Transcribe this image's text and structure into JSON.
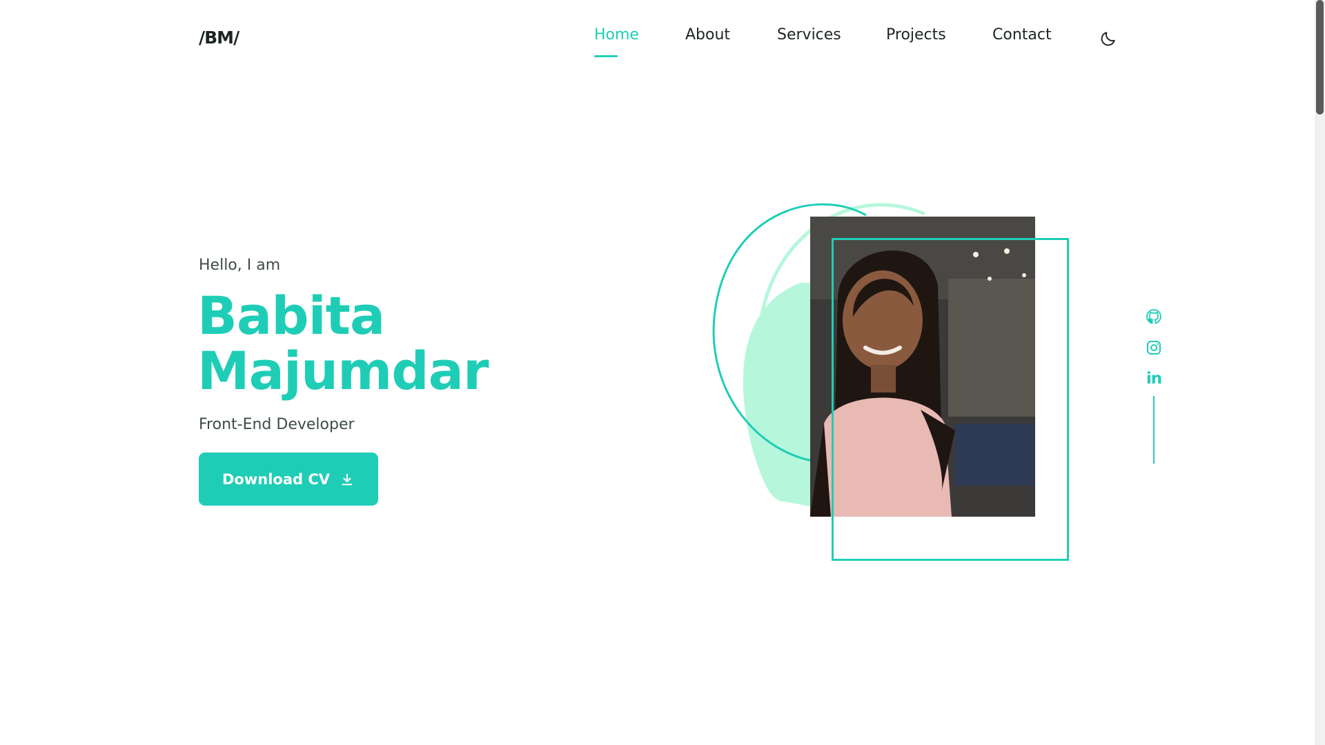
{
  "header": {
    "logo": "/BM/",
    "nav": {
      "home": "Home",
      "about": "About",
      "services": "Services",
      "projects": "Projects",
      "contact": "Contact"
    },
    "active_item": "Home",
    "theme_toggle_icon": "moon-icon"
  },
  "hero": {
    "greeting": "Hello, I am",
    "name_line1": "Babita",
    "name_line2": "Majumdar",
    "role": "Front-End Developer",
    "cta_label": "Download CV",
    "cta_icon": "download-icon"
  },
  "social": {
    "github_icon": "github-icon",
    "instagram_icon": "instagram-icon",
    "linkedin_label": "in"
  },
  "colors": {
    "accent": "#1fcdb6",
    "blob": "#b6f7dc",
    "text": "#1d2424",
    "muted": "#3f4a4a"
  }
}
